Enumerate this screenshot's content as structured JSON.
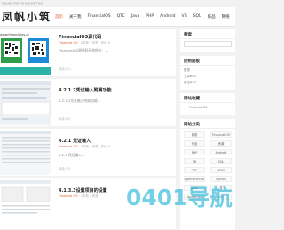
{
  "site": {
    "logo": "凤帆小筑",
    "topline": "欢迎光临 凤帆小筑 免费资源下载站"
  },
  "nav": {
    "items": [
      "首页",
      "关于我",
      "FinancialOS",
      "QTC",
      "Java",
      "PHP",
      "Android",
      "VB",
      "SQL",
      "作品",
      "网络"
    ]
  },
  "posts": [
    {
      "title": "FinancialOS源代码",
      "author": "Financial OS",
      "meta": " · 2年前 · 浏览  ·  评论 0",
      "excerpt": "FinancialOS源代码开放地址：…",
      "foot": "阅读(11) ·",
      "thumb": "qr",
      "thumb_url": "www.financialos.cc"
    },
    {
      "title": "4.2.1.2凭证输入附属功能",
      "author": "",
      "meta": "",
      "excerpt": "4.2.1.2凭证输入附属功能…",
      "foot": "阅读(10) ·",
      "thumb": "screen"
    },
    {
      "title": "4.2.1 凭证输入",
      "author": "Financial OS",
      "meta": " · 2年前 · 浏览  ·  评论 0",
      "excerpt": "4.2.1 凭证输入…",
      "foot": "阅读(13) ·",
      "thumb": "screen"
    },
    {
      "title": "4.1.3.3设置项目的设置",
      "author": "Financial OS",
      "meta": " · 2年前 · 浏览",
      "excerpt": "",
      "foot": "",
      "thumb": "screen"
    }
  ],
  "sidebar": {
    "search_title": "搜索",
    "search_placeholder": "",
    "link_title": "控制面板",
    "link_items": [
      "登录",
      "文章RSS",
      "评论RSS"
    ],
    "fav_title": "网站收藏",
    "fav_items": [
      "FinancialOS"
    ],
    "cat_title": "网站分类",
    "cats": [
      [
        "网络",
        "Financial OS"
      ],
      [
        "作品",
        "资源"
      ],
      [
        "PHP",
        "Android"
      ],
      [
        "VB",
        "SQL"
      ],
      [
        "QTC",
        "HTML"
      ],
      [
        "openWRP.rdoc",
        "Python"
      ],
      [
        "Java",
        "多"
      ],
      [
        "JavaScript",
        "GO"
      ]
    ]
  },
  "watermark": "0401导航",
  "colors": {
    "accent": "#e05b2b",
    "watermark": "#00aad2"
  }
}
